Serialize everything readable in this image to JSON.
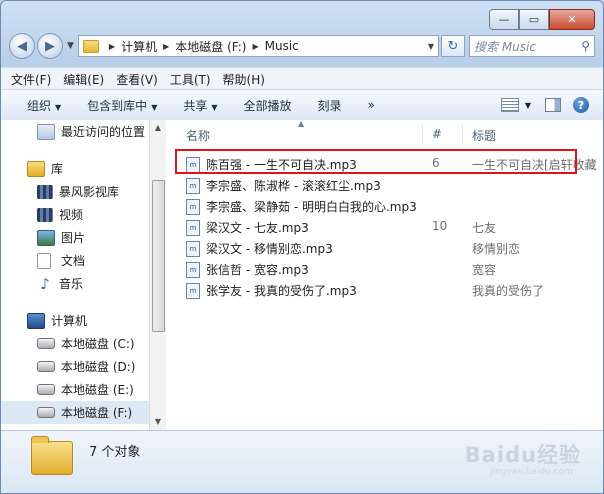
{
  "window": {
    "controls": [
      "—",
      "▭",
      "✕"
    ]
  },
  "nav": {
    "address": [
      "计算机",
      "本地磁盘 (F:)",
      "Music"
    ],
    "search_placeholder": "搜索 Music"
  },
  "menu": [
    "文件(F)",
    "编辑(E)",
    "查看(V)",
    "工具(T)",
    "帮助(H)"
  ],
  "toolbar": [
    "组织",
    "包含到库中",
    "共享",
    "全部播放",
    "刻录",
    "»"
  ],
  "sidebar": {
    "recent": "最近访问的位置",
    "library": "库",
    "lib_items": [
      "暴风影视库",
      "视频",
      "图片",
      "文档",
      "音乐"
    ],
    "computer": "计算机",
    "drives": [
      "本地磁盘 (C:)",
      "本地磁盘 (D:)",
      "本地磁盘 (E:)",
      "本地磁盘 (F:)"
    ]
  },
  "columns": {
    "name": "名称",
    "num": "#",
    "title": "标题"
  },
  "files": [
    {
      "name": "陈百强 - 一生不可自决.mp3",
      "num": "6",
      "title": "一生不可自决[启轩收藏"
    },
    {
      "name": "李宗盛、陈淑桦 - 滚滚红尘.mp3",
      "num": "",
      "title": ""
    },
    {
      "name": "李宗盛、梁静茹 - 明明白白我的心.mp3",
      "num": "",
      "title": ""
    },
    {
      "name": "梁汉文 - 七友.mp3",
      "num": "10",
      "title": "七友"
    },
    {
      "name": "梁汉文 - 移情别恋.mp3",
      "num": "",
      "title": "移情别恋"
    },
    {
      "name": "张信哲 - 宽容.mp3",
      "num": "",
      "title": "宽容"
    },
    {
      "name": "张学友 - 我真的受伤了.mp3",
      "num": "",
      "title": "我真的受伤了"
    }
  ],
  "status": {
    "count": "7 个对象"
  },
  "watermark": {
    "main": "Baidu经验",
    "sub": "jingyan.baidu.com"
  },
  "accent": {
    "highlight": "#d9141b"
  }
}
